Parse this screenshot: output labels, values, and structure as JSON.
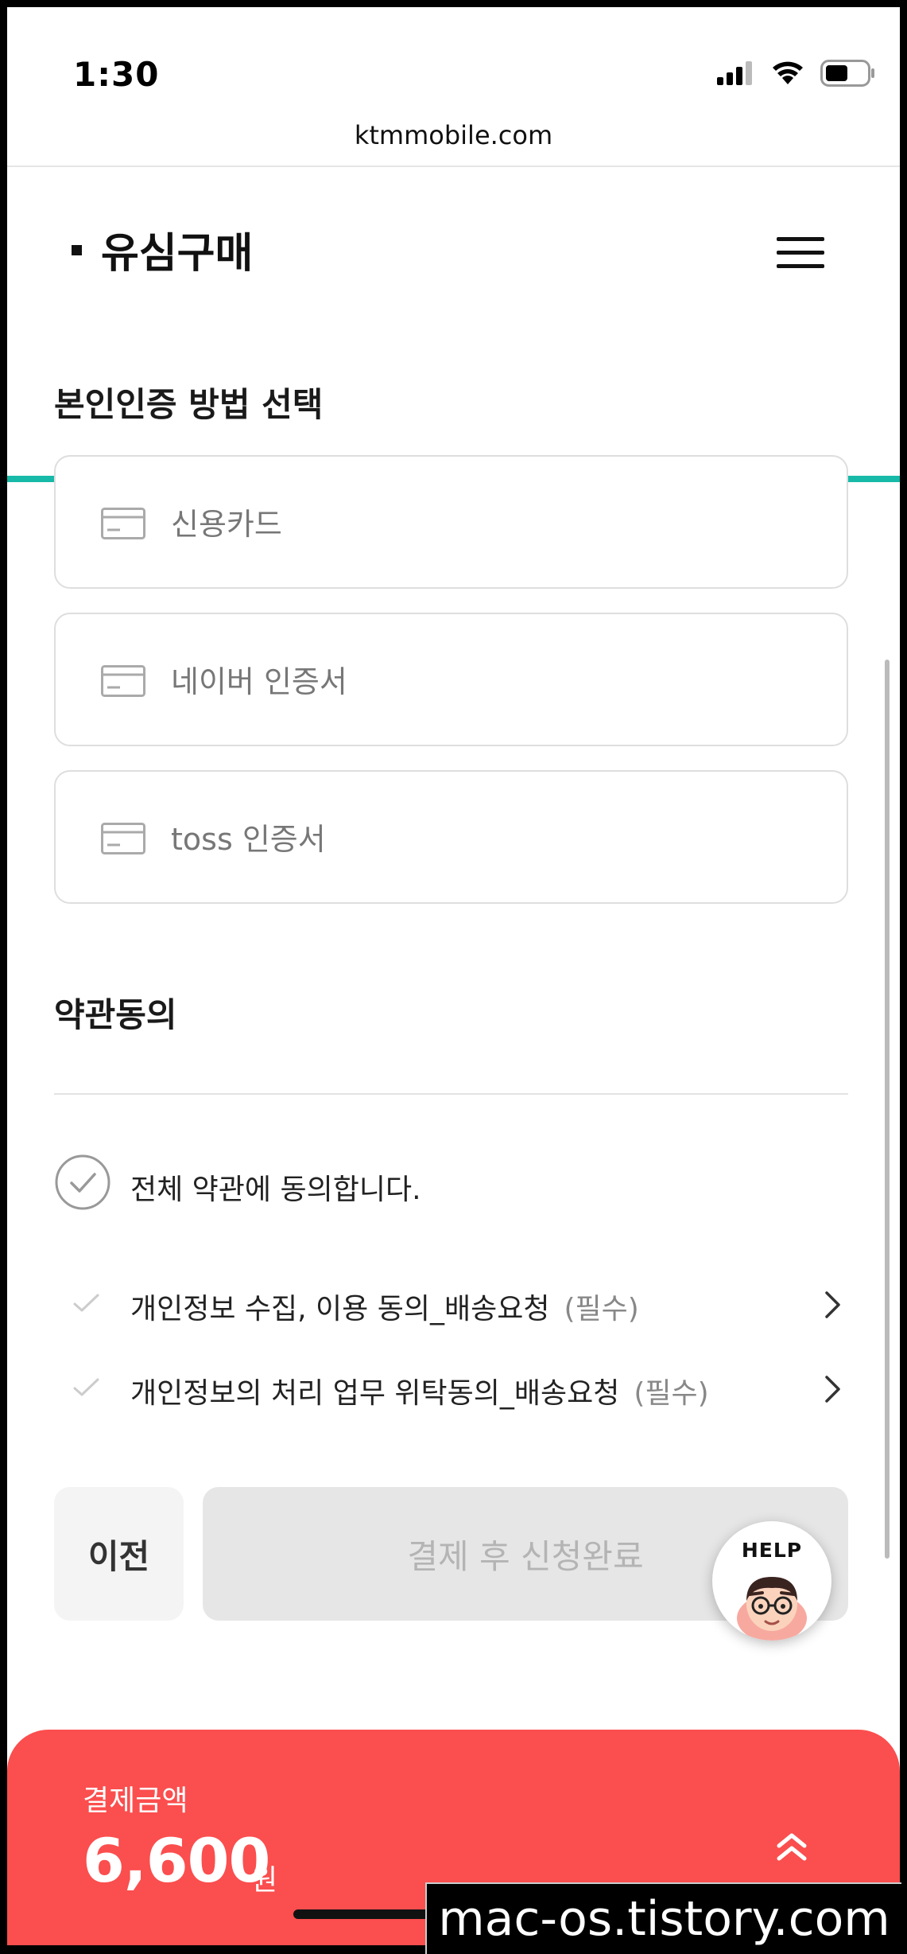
{
  "status_bar": {
    "time": "1:30",
    "icons": [
      "signal-icon",
      "wifi-icon",
      "battery-icon"
    ]
  },
  "browser": {
    "url": "ktmmobile.com"
  },
  "header": {
    "title": "유심구매",
    "menu_icon": "hamburger-menu-icon",
    "accent_color": "#17b9a8"
  },
  "auth": {
    "title": "본인인증 방법 선택",
    "options": [
      {
        "label": "신용카드",
        "icon": "card-icon"
      },
      {
        "label": "네이버 인증서",
        "icon": "card-icon"
      },
      {
        "label": "toss 인증서",
        "icon": "card-icon"
      }
    ]
  },
  "terms": {
    "title": "약관동의",
    "agree_all": "전체 약관에 동의합니다.",
    "items": [
      {
        "label": "개인정보 수집, 이용 동의_배송요청",
        "required": "(필수)"
      },
      {
        "label": "개인정보의 처리 업무 위탁동의_배송요청",
        "required": "(필수)"
      }
    ]
  },
  "buttons": {
    "prev": "이전",
    "submit": "결제 후 신청완료",
    "help": "HELP"
  },
  "payment": {
    "label": "결제금액",
    "amount": "6,600",
    "unit": "원",
    "color": "#fb4e4e"
  },
  "watermark": "mac-os.tistory.com"
}
